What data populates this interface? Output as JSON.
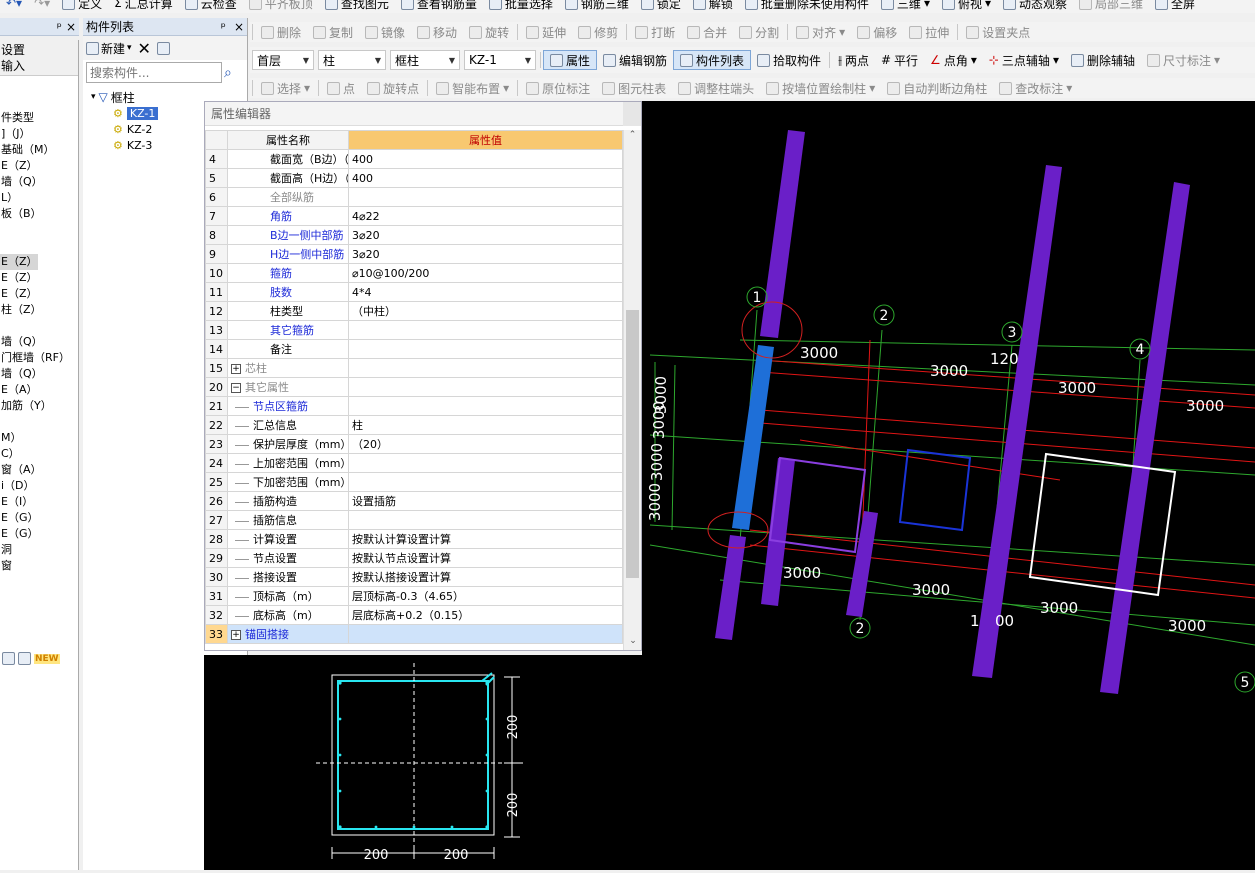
{
  "toolbar1": {
    "items": [
      "定义",
      "汇总计算",
      "云检查",
      "平齐板顶",
      "查找图元",
      "查看钢筋量",
      "批量选择",
      "钢筋三维",
      "锁定",
      "解锁",
      "批量删除未使用构件",
      "三维",
      "俯视",
      "动态观察",
      "局部三维",
      "全屏"
    ]
  },
  "toolbar2": {
    "items": [
      "删除",
      "复制",
      "镜像",
      "移动",
      "旋转",
      "延伸",
      "修剪",
      "打断",
      "合并",
      "分割",
      "对齐",
      "偏移",
      "拉伸",
      "设置夹点"
    ]
  },
  "toolbar3": {
    "floor": "首层",
    "category": "柱",
    "type": "框柱",
    "component": "KZ-1",
    "items": [
      "属性",
      "编辑钢筋",
      "构件列表",
      "拾取构件",
      "两点",
      "平行",
      "点角",
      "三点辅轴",
      "删除辅轴",
      "尺寸标注"
    ]
  },
  "toolbar4": {
    "items": [
      "选择",
      "点",
      "旋转点",
      "智能布置",
      "原位标注",
      "图元柱表",
      "调整柱端头",
      "按墙位置绘制柱",
      "自动判断边角柱",
      "查改标注"
    ]
  },
  "left_panel": {
    "rows": [
      {
        "label": "设置"
      },
      {
        "label": "输入"
      },
      {
        "label": "件类型"
      },
      {
        "label": "]（J）"
      },
      {
        "label": "基础（M）"
      },
      {
        "label": "E（Z）"
      },
      {
        "label": "墙（Q）"
      },
      {
        "label": "L）"
      },
      {
        "label": "板（B）"
      },
      {
        "label": "E（Z）",
        "selected": true
      },
      {
        "label": "E（Z）"
      },
      {
        "label": "E（Z）"
      },
      {
        "label": "柱（Z）"
      },
      {
        "label": "墙（Q）"
      },
      {
        "label": "门框墙（RF）"
      },
      {
        "label": "墙（Q）"
      },
      {
        "label": "E（A）"
      },
      {
        "label": "加筋（Y）"
      },
      {
        "label": "M）"
      },
      {
        "label": "C）"
      },
      {
        "label": "窗（A）"
      },
      {
        "label": "i（D）"
      },
      {
        "label": "E（I）"
      },
      {
        "label": "E（G）"
      },
      {
        "label": "E（G）"
      },
      {
        "label": "洞"
      },
      {
        "label": "窗"
      }
    ],
    "new_badge": "NEW"
  },
  "component_list": {
    "title": "构件列表",
    "pin": "ᵖ",
    "close": "×",
    "new_label": "新建",
    "search_placeholder": "搜索构件...",
    "root": "框柱",
    "items": [
      "KZ-1",
      "KZ-2",
      "KZ-3"
    ],
    "selected": "KZ-1"
  },
  "property_editor": {
    "title": "属性编辑器",
    "col_name": "属性名称",
    "col_value": "属性值",
    "rows": [
      {
        "n": "4",
        "name": "截面宽（B边）（mm）",
        "value": "400",
        "style": "normal"
      },
      {
        "n": "5",
        "name": "截面高（H边）（mm）",
        "value": "400",
        "style": "normal"
      },
      {
        "n": "6",
        "name": "全部纵筋",
        "value": "",
        "style": "gray"
      },
      {
        "n": "7",
        "name": "角筋",
        "value": "4⌀22",
        "style": "blue"
      },
      {
        "n": "8",
        "name": "B边一侧中部筋",
        "value": "3⌀20",
        "style": "blue"
      },
      {
        "n": "9",
        "name": "H边一侧中部筋",
        "value": "3⌀20",
        "style": "blue"
      },
      {
        "n": "10",
        "name": "箍筋",
        "value": "⌀10@100/200",
        "style": "blue"
      },
      {
        "n": "11",
        "name": "肢数",
        "value": "4*4",
        "style": "blue"
      },
      {
        "n": "12",
        "name": "柱类型",
        "value": "（中柱）",
        "style": "normal"
      },
      {
        "n": "13",
        "name": "其它箍筋",
        "value": "",
        "style": "blue"
      },
      {
        "n": "14",
        "name": "备注",
        "value": "",
        "style": "normal"
      },
      {
        "n": "15",
        "name": "芯柱",
        "value": "",
        "style": "gray",
        "expander": "+"
      },
      {
        "n": "20",
        "name": "其它属性",
        "value": "",
        "style": "gray",
        "expander": "−"
      },
      {
        "n": "21",
        "name": "节点区箍筋",
        "value": "",
        "style": "blue",
        "child": true
      },
      {
        "n": "22",
        "name": "汇总信息",
        "value": "柱",
        "style": "normal",
        "child": true
      },
      {
        "n": "23",
        "name": "保护层厚度（mm）",
        "value": "（20）",
        "style": "normal",
        "child": true
      },
      {
        "n": "24",
        "name": "上加密范围（mm）",
        "value": "",
        "style": "normal",
        "child": true
      },
      {
        "n": "25",
        "name": "下加密范围（mm）",
        "value": "",
        "style": "normal",
        "child": true
      },
      {
        "n": "26",
        "name": "插筋构造",
        "value": "设置插筋",
        "style": "normal",
        "child": true
      },
      {
        "n": "27",
        "name": "插筋信息",
        "value": "",
        "style": "normal",
        "child": true
      },
      {
        "n": "28",
        "name": "计算设置",
        "value": "按默认计算设置计算",
        "style": "normal",
        "child": true
      },
      {
        "n": "29",
        "name": "节点设置",
        "value": "按默认节点设置计算",
        "style": "normal",
        "child": true
      },
      {
        "n": "30",
        "name": "搭接设置",
        "value": "按默认搭接设置计算",
        "style": "normal",
        "child": true
      },
      {
        "n": "31",
        "name": "顶标高（m）",
        "value": "层顶标高-0.3（4.65）",
        "style": "normal",
        "child": true
      },
      {
        "n": "32",
        "name": "底标高（m）",
        "value": "层底标高+0.2（0.15）",
        "style": "normal",
        "child": true
      },
      {
        "n": "33",
        "name": "锚固搭接",
        "value": "",
        "style": "blue",
        "expander": "+",
        "selected": true
      }
    ]
  },
  "preview": {
    "dim_v1": "200",
    "dim_v2": "200",
    "dim_h1": "200",
    "dim_h2": "200"
  },
  "viewport": {
    "axis_labels": [
      "1",
      "2",
      "3",
      "4",
      "2",
      "5"
    ],
    "dims": [
      "3000",
      "3000",
      "3000",
      "3000",
      "3000",
      "3000",
      "3000",
      "3000",
      "3000",
      "3000",
      "3000",
      "3000",
      "3000",
      "120",
      "1",
      "00"
    ]
  },
  "colors": {
    "column": "#6a1fc8",
    "selected_column": "#1e6fd8",
    "grid_green": "#2ea82e",
    "grid_red": "#e01515",
    "bg": "#000000"
  }
}
